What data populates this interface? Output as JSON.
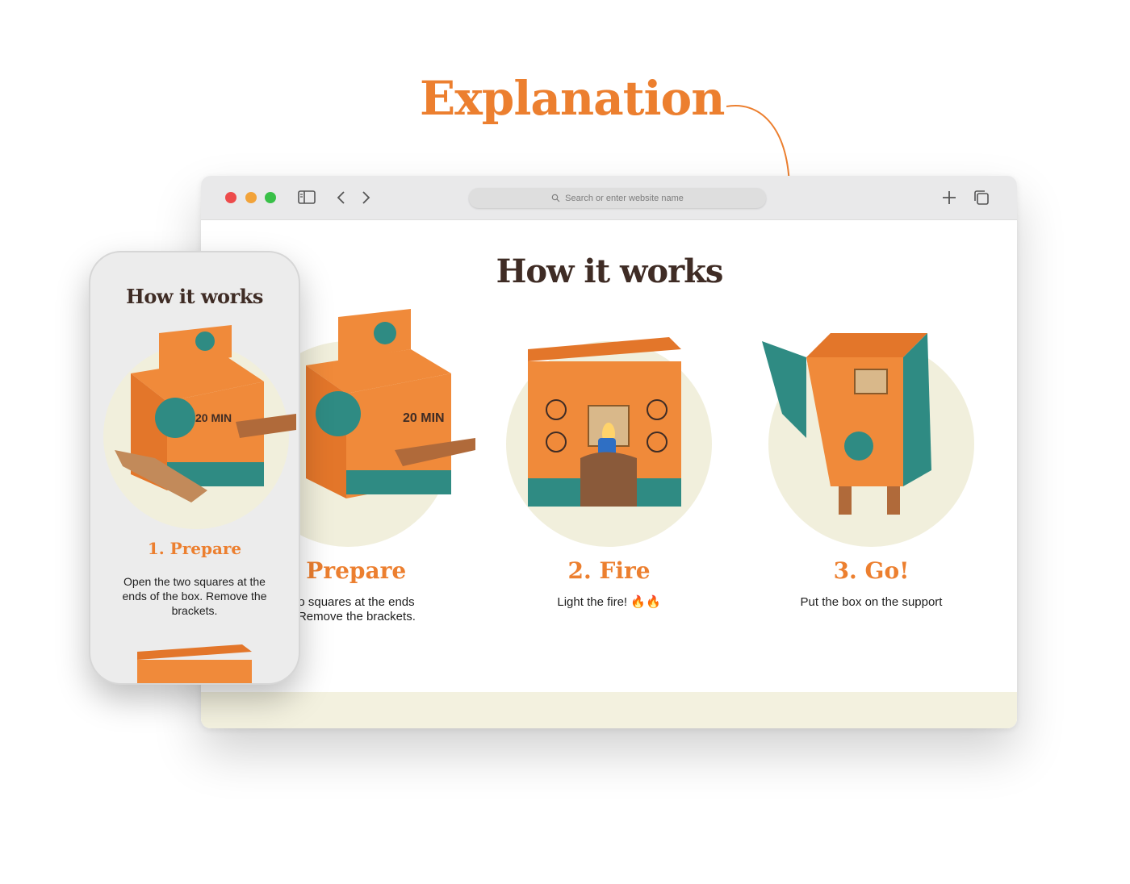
{
  "headline": "Explanation",
  "browser": {
    "search_placeholder": "Search or enter website name"
  },
  "page": {
    "title": "How it works",
    "steps": [
      {
        "title": "1. Prepare",
        "description": "Open the two squares at the ends of the box. Remove the brackets.",
        "visible_title": ". Prepare",
        "visible_desc_line1": "two squares at the ends",
        "visible_desc_line2": "x. Remove the brackets."
      },
      {
        "title": "2. Fire",
        "description": "Light the fire! 🔥🔥"
      },
      {
        "title": "3. Go!",
        "description": "Put the box on the support"
      }
    ]
  },
  "mobile": {
    "title": "How it works",
    "step_title": "1. Prepare",
    "step_description": "Open the two squares at the ends of the box. Remove the brackets."
  },
  "colors": {
    "accent_orange": "#ec7f2f",
    "title_brown": "#3f2c25",
    "circle_cream": "#f1efdc",
    "box_teal": "#2f8b83"
  },
  "icons": [
    "close-dot",
    "minimize-dot",
    "zoom-dot",
    "sidebar-icon",
    "back-icon",
    "forward-icon",
    "search-icon",
    "new-tab-icon",
    "tabs-icon"
  ]
}
